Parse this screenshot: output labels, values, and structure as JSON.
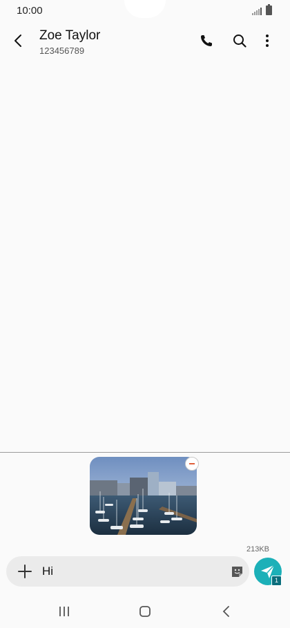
{
  "status_bar": {
    "time": "10:00"
  },
  "header": {
    "contact_name": "Zoe Taylor",
    "contact_number": "123456789",
    "icons": [
      "back-icon",
      "phone-icon",
      "search-icon",
      "more-options-icon"
    ]
  },
  "attachment": {
    "type": "photo",
    "description": "harbour marina with boats and buildings",
    "size": "213KB"
  },
  "composer": {
    "message_text": "Hi",
    "recipient_count_badge": "1"
  },
  "colors": {
    "accent": "#1cb0b8",
    "remove": "#e0603a",
    "background": "#fafafa",
    "input_bg": "#ebebeb"
  },
  "nav_bar": {
    "icons": [
      "recent-apps-icon",
      "home-icon",
      "back-icon"
    ]
  }
}
